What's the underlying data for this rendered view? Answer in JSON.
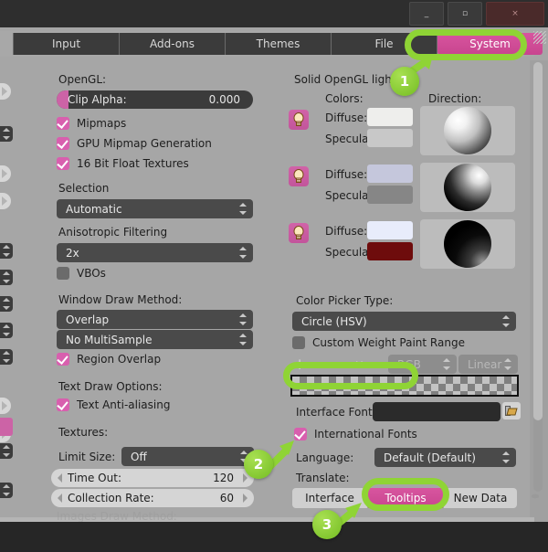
{
  "window": {
    "buttons": [
      {
        "name": "minimize",
        "glyph": "_"
      },
      {
        "name": "maximize",
        "glyph": "▫"
      },
      {
        "name": "close",
        "glyph": "×"
      }
    ]
  },
  "tabs": [
    {
      "label": "Input",
      "active": false
    },
    {
      "label": "Add-ons",
      "active": false
    },
    {
      "label": "Themes",
      "active": false
    },
    {
      "label": "File",
      "active": false
    },
    {
      "label": "System",
      "active": true
    }
  ],
  "left_panel": {
    "opengl_header": "OpenGL:",
    "clip_alpha": {
      "label": "Clip Alpha:",
      "value": "0.000"
    },
    "checks": [
      {
        "label": "Mipmaps",
        "checked": true
      },
      {
        "label": "GPU Mipmap Generation",
        "checked": true
      },
      {
        "label": "16 Bit Float Textures",
        "checked": true
      }
    ],
    "selection_header": "Selection",
    "selection_value": "Automatic",
    "aniso_header": "Anisotropic Filtering",
    "aniso_value": "2x",
    "vbos": {
      "label": "VBOs",
      "checked": false
    },
    "window_draw_header": "Window Draw Method:",
    "window_draw_value": "Overlap",
    "multisample_value": "No MultiSample",
    "region_overlap": {
      "label": "Region Overlap",
      "checked": true
    },
    "text_draw_header": "Text Draw Options:",
    "text_aa": {
      "label": "Text Anti-aliasing",
      "checked": true
    },
    "textures_header": "Textures:",
    "limit_size": {
      "label": "Limit Size:",
      "value": "Off"
    },
    "time_out": {
      "label": "Time Out:",
      "value": "120"
    },
    "collection_rate": {
      "label": "Collection Rate:",
      "value": "60"
    },
    "cut_off_header": "Images Draw Method:"
  },
  "right_panel": {
    "lights_header": "Solid OpenGL lights:",
    "colors_header": "Colors:",
    "direction_header": "Direction:",
    "lights": [
      {
        "diffuse_label": "Diffuse:",
        "specular_label": "Specula",
        "diffuse_color": "#eeeeec",
        "specular_color": "#c8c8c8",
        "enabled": true
      },
      {
        "diffuse_label": "Diffuse:",
        "specular_label": "Specula",
        "diffuse_color": "#c5c7dc",
        "specular_color": "#868686",
        "enabled": true
      },
      {
        "diffuse_label": "Diffuse:",
        "specular_label": "Specula",
        "diffuse_color": "#e8ecfb",
        "specular_color": "#6e0c0c",
        "enabled": true
      }
    ],
    "color_picker_header": "Color Picker Type:",
    "color_picker_value": "Circle (HSV)",
    "custom_weight": {
      "label": "Custom Weight Paint Range",
      "checked": false
    },
    "ramp_tools": [
      "+",
      "−",
      "⇔"
    ],
    "ramp_mode": "RGB",
    "ramp_interp": "Linear",
    "interface_font": {
      "label": "Interface Font:",
      "value": ""
    },
    "international_fonts": {
      "label": "International Fonts",
      "checked": true
    },
    "language": {
      "label": "Language:",
      "value": "Default (Default)"
    },
    "translate_label": "Translate:",
    "translate_buttons": [
      {
        "label": "Interface",
        "active": false
      },
      {
        "label": "Tooltips",
        "active": true
      },
      {
        "label": "New Data",
        "active": false
      }
    ]
  },
  "annotations": [
    {
      "number": "1",
      "target": "system-tab"
    },
    {
      "number": "2",
      "target": "international-fonts-checkbox"
    },
    {
      "number": "3",
      "target": "tooltips-button"
    }
  ],
  "colors": {
    "accent_pink": "#cc63a6",
    "highlight_green": "#8fd435",
    "panel_bg": "#a6a6a6",
    "widget_dark": "#3b3b3b"
  }
}
